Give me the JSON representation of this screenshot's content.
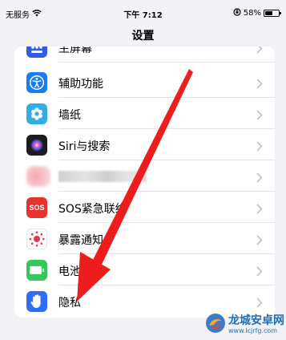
{
  "status_bar": {
    "carrier": "无服务",
    "time": "下午 7:12",
    "battery_percent": "58%",
    "battery_level": 0.58,
    "icons": [
      "wifi-icon",
      "lock-rotation-icon",
      "battery-icon"
    ]
  },
  "nav": {
    "title": "设置"
  },
  "settings_rows": [
    {
      "label": "主屏幕",
      "icon": "home-screen-icon",
      "color": "#2f5bea"
    },
    {
      "label": "辅助功能",
      "icon": "accessibility-icon",
      "color": "#1a7cf5"
    },
    {
      "label": "墙纸",
      "icon": "wallpaper-icon",
      "color": "#32ade6"
    },
    {
      "label": "Siri与搜索",
      "icon": "siri-icon",
      "color": "#1c1c1e"
    },
    {
      "label": "",
      "icon": "blurred-icon",
      "color": "#f4a3ad"
    },
    {
      "label": "SOS紧急联络",
      "icon": "sos-icon",
      "color": "#e5322d",
      "icon_text": "SOS"
    },
    {
      "label": "暴露通知",
      "icon": "exposure-notification-icon",
      "color": "#ffffff"
    },
    {
      "label": "电池",
      "icon": "battery-icon",
      "color": "#34c759"
    },
    {
      "label": "隐私",
      "icon": "hand-icon",
      "color": "#2f6df6"
    }
  ],
  "watermark": {
    "name": "龙城安卓网",
    "url": "www.lcjrfg.com"
  }
}
